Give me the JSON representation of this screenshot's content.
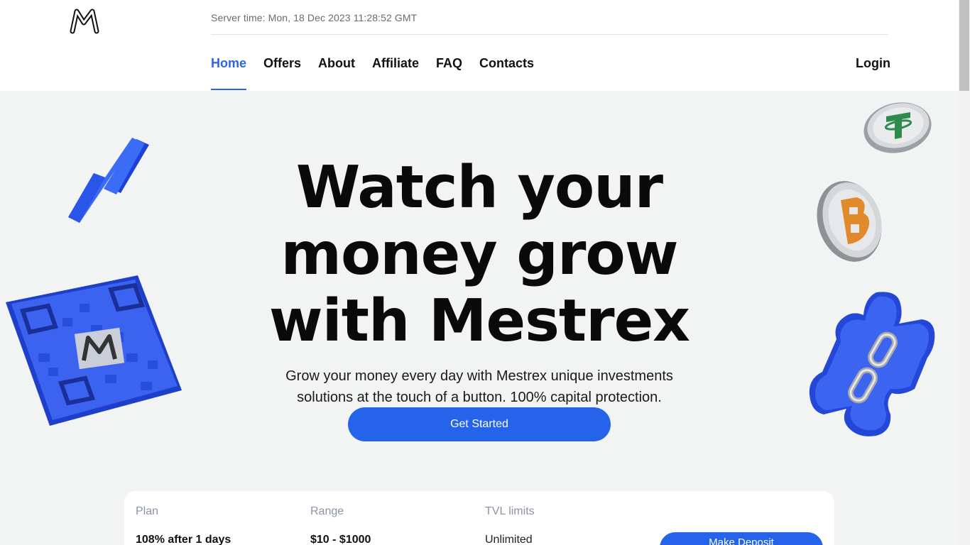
{
  "header": {
    "logo_icon": "mestrex-logo-icon",
    "server_time": "Server time: Mon, 18 Dec 2023 11:28:52 GMT",
    "nav": [
      {
        "label": "Home",
        "active": true
      },
      {
        "label": "Offers",
        "active": false
      },
      {
        "label": "About",
        "active": false
      },
      {
        "label": "Affiliate",
        "active": false
      },
      {
        "label": "FAQ",
        "active": false
      },
      {
        "label": "Contacts",
        "active": false
      }
    ],
    "login_label": "Login"
  },
  "hero": {
    "title": "Watch your money grow with Mestrex",
    "subtitle": "Grow your money every day with Mestrex unique investments solutions at the touch of a button. 100% capital protection.",
    "cta_label": "Get Started"
  },
  "decorations": [
    "lightning-icon",
    "qr-code-icon",
    "tether-coin-icon",
    "bitcoin-coin-icon",
    "puzzle-chain-icon"
  ],
  "plans": {
    "headers": {
      "plan": "Plan",
      "range": "Range",
      "tvl": "TVL limits"
    },
    "rows": [
      {
        "plan": "108% after 1 days",
        "range": "$10 - $1000",
        "tvl": "Unlimited",
        "button": "Make Deposit"
      }
    ]
  },
  "colors": {
    "accent": "#2563eb",
    "background": "#f2f3f3"
  }
}
